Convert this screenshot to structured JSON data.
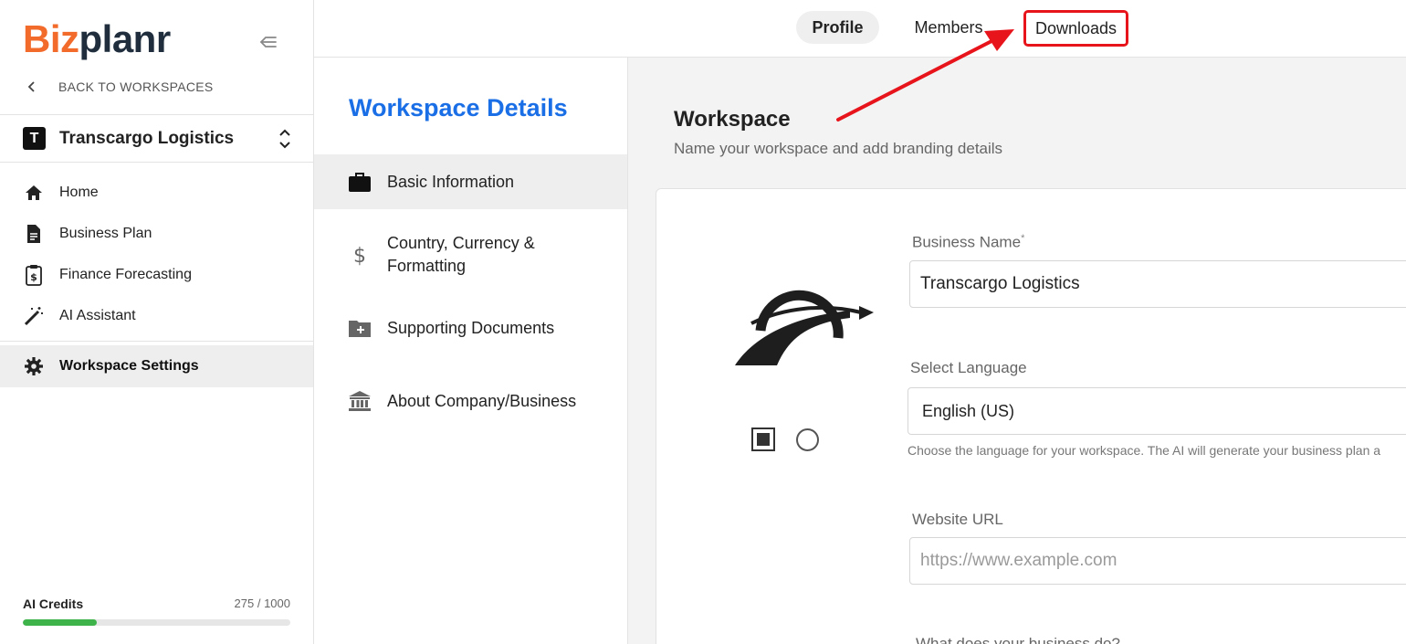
{
  "brand": {
    "part1": "Biz",
    "part2": "planr",
    "accent_color": "#f26b2a",
    "dark_color": "#1f2d3d"
  },
  "sidebar": {
    "back_label": "BACK TO WORKSPACES",
    "workspace": {
      "initial": "T",
      "name": "Transcargo Logistics"
    },
    "items": [
      {
        "label": "Home",
        "icon": "home-icon"
      },
      {
        "label": "Business Plan",
        "icon": "document-icon"
      },
      {
        "label": "Finance Forecasting",
        "icon": "clipboard-dollar-icon"
      },
      {
        "label": "AI Assistant",
        "icon": "magic-wand-icon"
      }
    ],
    "active_item": {
      "label": "Workspace Settings",
      "icon": "gear-icon"
    },
    "credits": {
      "label": "AI Credits",
      "value_text": "275 / 1000",
      "used": 275,
      "total": 1000,
      "bar_color": "#3db34a"
    }
  },
  "tabs": [
    {
      "label": "Profile",
      "active": true
    },
    {
      "label": "Members",
      "active": false
    },
    {
      "label": "Downloads",
      "active": false,
      "highlighted": true
    }
  ],
  "subnav": {
    "title": "Workspace Details",
    "title_color": "#1a6ee6",
    "items": [
      {
        "label": "Basic Information",
        "icon": "briefcase-icon",
        "active": true
      },
      {
        "label_line1": "Country, Currency &",
        "label_line2": "Formatting",
        "icon": "dollar-icon"
      },
      {
        "label": "Supporting Documents",
        "icon": "folder-plus-icon"
      },
      {
        "label": "About Company/Business",
        "icon": "bank-icon"
      }
    ]
  },
  "main": {
    "title": "Workspace",
    "subtitle": "Name your workspace and add branding details",
    "form": {
      "business_name": {
        "label": "Business Name",
        "required_mark": "*",
        "value": "Transcargo Logistics"
      },
      "language": {
        "label": "Select Language",
        "value": "English (US)",
        "help": "Choose the language for your workspace. The AI will generate your business plan a"
      },
      "website": {
        "label": "Website URL",
        "placeholder": "https://www.example.com"
      },
      "business_desc": {
        "label": "What does your business do?"
      }
    }
  },
  "annotation": {
    "arrow_color": "#e8141c",
    "highlight_color": "#e8141c"
  }
}
